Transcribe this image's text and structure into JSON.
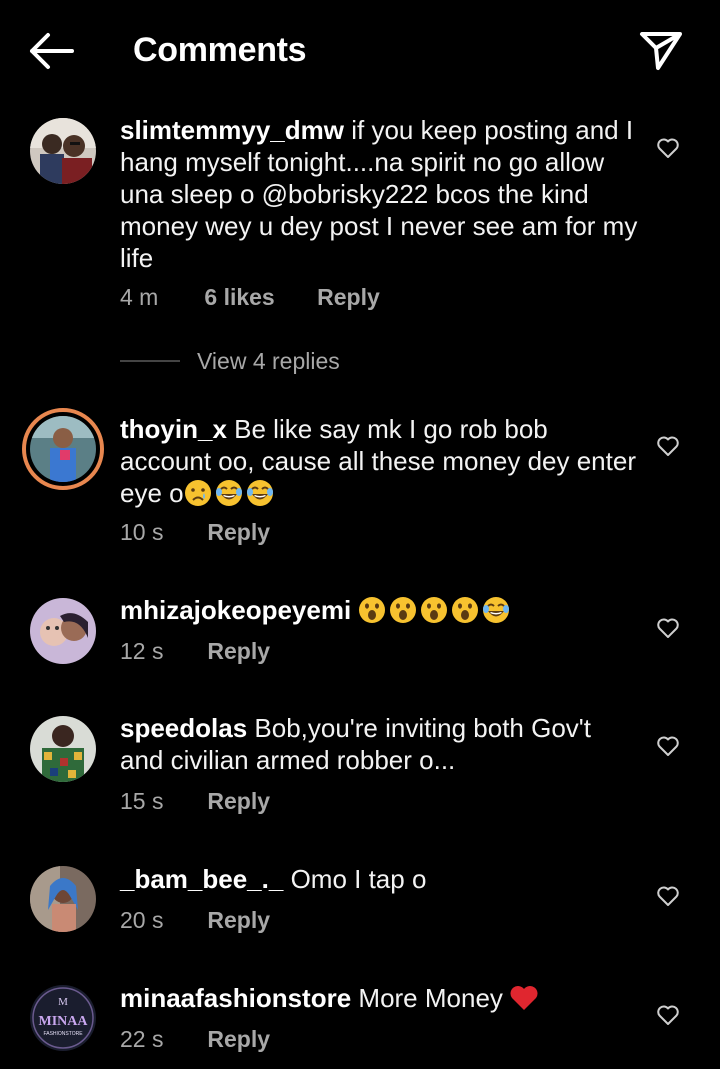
{
  "header": {
    "title": "Comments",
    "back_icon": "arrow-left-icon",
    "send_icon": "paper-plane-icon"
  },
  "comments": [
    {
      "username": "slimtemmyy_dmw",
      "text": "if you keep posting and I hang myself tonight....na spirit no go allow una sleep o @bobrisky222 bcos the kind money wey u dey post I never see am for my life",
      "time": "4 m",
      "likes": "6 likes",
      "reply": "Reply",
      "view_replies": "View 4 replies"
    },
    {
      "username": "thoyin_x",
      "text": "Be like say mk I go rob bob account oo, cause all these money dey enter eye o",
      "emojis": [
        "crying-face",
        "tears-of-joy",
        "tears-of-joy"
      ],
      "time": "10 s",
      "reply": "Reply"
    },
    {
      "username": "mhizajokeopeyemi",
      "text": "",
      "emojis": [
        "hushed-face",
        "hushed-face",
        "hushed-face",
        "hushed-face",
        "tears-of-joy"
      ],
      "time": "12 s",
      "reply": "Reply"
    },
    {
      "username": "speedolas",
      "text": "Bob,you're inviting both Gov't and civilian armed robber o...",
      "time": "15 s",
      "reply": "Reply"
    },
    {
      "username": "_bam_bee_._",
      "text": "Omo I tap o",
      "time": "20 s",
      "reply": "Reply"
    },
    {
      "username": "minaafashionstore",
      "text": "More Money",
      "emojis": [
        "red-heart"
      ],
      "time": "22 s",
      "reply": "Reply"
    }
  ],
  "avatars": {
    "minaa_logo_text": "MINAA",
    "minaa_logo_subtext": "FASHIONSTORE"
  },
  "colors": {
    "background": "#000000",
    "text": "#ffffff",
    "muted": "#a8a8a8",
    "story_ring": "#e8874f",
    "heart_red": "#e0262f"
  }
}
